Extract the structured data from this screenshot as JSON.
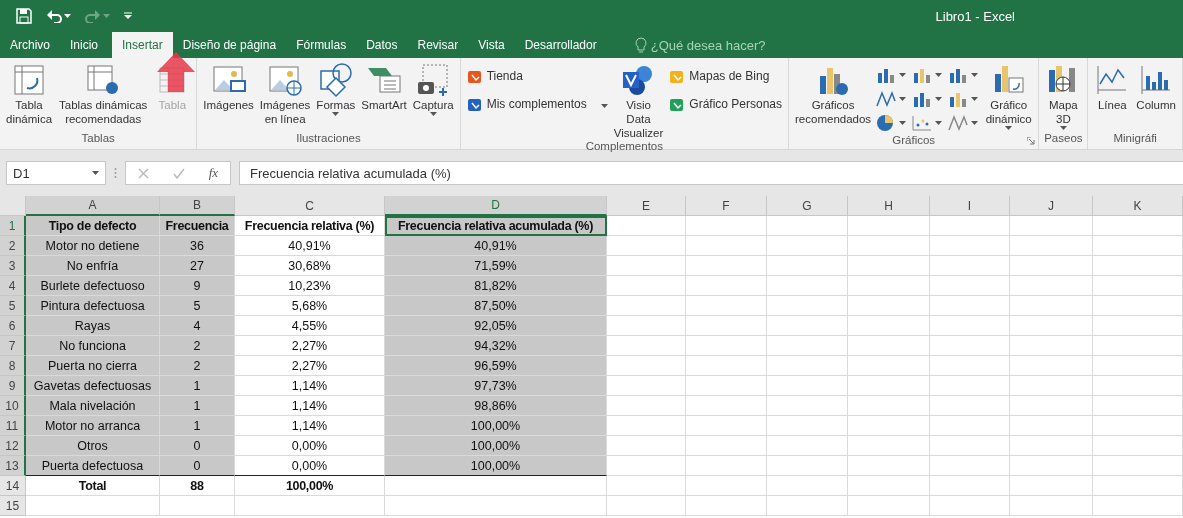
{
  "window": {
    "title": "Libro1 - Excel",
    "redo_disabled": true
  },
  "tabs": [
    {
      "label": "Archivo",
      "selected": false
    },
    {
      "label": "Inicio",
      "selected": false
    },
    {
      "label": "Insertar",
      "selected": true
    },
    {
      "label": "Diseño de página",
      "selected": false
    },
    {
      "label": "Fórmulas",
      "selected": false
    },
    {
      "label": "Datos",
      "selected": false
    },
    {
      "label": "Revisar",
      "selected": false
    },
    {
      "label": "Vista",
      "selected": false
    },
    {
      "label": "Desarrollador",
      "selected": false
    }
  ],
  "tell_me": {
    "placeholder": "¿Qué desea hacer?"
  },
  "ribbon": {
    "groups": [
      {
        "label": "Tablas",
        "items": [
          {
            "kind": "large",
            "label": "Tabla dinámica",
            "disabled": false,
            "dropdown": false
          },
          {
            "kind": "large",
            "label": "Tablas dinámicas recomendadas",
            "disabled": false,
            "dropdown": false
          },
          {
            "kind": "large",
            "label": "Tabla",
            "disabled": true,
            "dropdown": false
          }
        ]
      },
      {
        "label": "Ilustraciones",
        "items": [
          {
            "kind": "large",
            "label": "Imágenes",
            "disabled": false,
            "dropdown": false
          },
          {
            "kind": "large",
            "label": "Imágenes en línea",
            "disabled": false,
            "dropdown": false
          },
          {
            "kind": "large",
            "label": "Formas",
            "disabled": false,
            "dropdown": true
          },
          {
            "kind": "large",
            "label": "SmartArt",
            "disabled": false,
            "dropdown": false
          },
          {
            "kind": "large",
            "label": "Captura",
            "disabled": false,
            "dropdown": true
          }
        ]
      },
      {
        "label": "Complementos",
        "items": [
          {
            "kind": "stack",
            "children": [
              {
                "label": "Tienda",
                "dropdown": false
              },
              {
                "label": "Mis complementos",
                "dropdown": true
              }
            ]
          },
          {
            "kind": "large",
            "label": "Visio Data Visualizer",
            "disabled": false,
            "dropdown": false
          },
          {
            "kind": "stack",
            "children": [
              {
                "label": "Mapas de Bing",
                "dropdown": false
              },
              {
                "label": "Gráfico Personas",
                "dropdown": false
              }
            ]
          }
        ]
      },
      {
        "label": "Gráficos",
        "launcher": true,
        "items": [
          {
            "kind": "large",
            "label": "Gráficos recomendados",
            "disabled": false,
            "dropdown": false
          },
          {
            "kind": "chartgrid"
          },
          {
            "kind": "large",
            "label": "Gráfico dinámico",
            "disabled": false,
            "dropdown": true
          }
        ]
      },
      {
        "label": "Paseos",
        "items": [
          {
            "kind": "large",
            "label": "Mapa 3D",
            "disabled": false,
            "dropdown": true
          }
        ]
      },
      {
        "label": "Minigráfi",
        "items": [
          {
            "kind": "large",
            "label": "Línea",
            "disabled": false,
            "dropdown": false
          },
          {
            "kind": "large",
            "label": "Column",
            "disabled": false,
            "dropdown": false
          }
        ]
      }
    ]
  },
  "formula_bar": {
    "name_box": "D1",
    "fx": "fx",
    "value": "Frecuencia relativa acumulada (%)"
  },
  "columns": [
    {
      "label": "A",
      "selected": true,
      "active": false
    },
    {
      "label": "B",
      "selected": true,
      "active": false
    },
    {
      "label": "C",
      "selected": false,
      "active": false
    },
    {
      "label": "D",
      "selected": true,
      "active": true
    },
    {
      "label": "E",
      "selected": false,
      "active": false
    },
    {
      "label": "F",
      "selected": false,
      "active": false
    },
    {
      "label": "G",
      "selected": false,
      "active": false
    },
    {
      "label": "H",
      "selected": false,
      "active": false
    },
    {
      "label": "I",
      "selected": false,
      "active": false
    },
    {
      "label": "J",
      "selected": false,
      "active": false
    },
    {
      "label": "K",
      "selected": false,
      "active": false
    }
  ],
  "rows": [
    {
      "number": "1",
      "kind": "header",
      "selected": true,
      "active": true,
      "cells": [
        "Tipo de defecto",
        "Frecuencia",
        "Frecuencia relativa (%)",
        "Frecuencia relativa acumulada (%)"
      ]
    },
    {
      "number": "2",
      "kind": "data",
      "selected": true,
      "active": false,
      "cells": [
        "Motor no detiene",
        "36",
        "40,91%",
        "40,91%"
      ]
    },
    {
      "number": "3",
      "kind": "data",
      "selected": true,
      "active": false,
      "cells": [
        "No enfría",
        "27",
        "30,68%",
        "71,59%"
      ]
    },
    {
      "number": "4",
      "kind": "data",
      "selected": true,
      "active": false,
      "cells": [
        "Burlete defectuoso",
        "9",
        "10,23%",
        "81,82%"
      ]
    },
    {
      "number": "5",
      "kind": "data",
      "selected": true,
      "active": false,
      "cells": [
        "Pintura defectuosa",
        "5",
        "5,68%",
        "87,50%"
      ]
    },
    {
      "number": "6",
      "kind": "data",
      "selected": true,
      "active": false,
      "cells": [
        "Rayas",
        "4",
        "4,55%",
        "92,05%"
      ]
    },
    {
      "number": "7",
      "kind": "data",
      "selected": true,
      "active": false,
      "cells": [
        "No funciona",
        "2",
        "2,27%",
        "94,32%"
      ]
    },
    {
      "number": "8",
      "kind": "data",
      "selected": true,
      "active": false,
      "cells": [
        "Puerta no cierra",
        "2",
        "2,27%",
        "96,59%"
      ]
    },
    {
      "number": "9",
      "kind": "data",
      "selected": true,
      "active": false,
      "cells": [
        "Gavetas defectuosas",
        "1",
        "1,14%",
        "97,73%"
      ]
    },
    {
      "number": "10",
      "kind": "data",
      "selected": true,
      "active": false,
      "cells": [
        "Mala nivelación",
        "1",
        "1,14%",
        "98,86%"
      ]
    },
    {
      "number": "11",
      "kind": "data",
      "selected": true,
      "active": false,
      "cells": [
        "Motor no arranca",
        "1",
        "1,14%",
        "100,00%"
      ]
    },
    {
      "number": "12",
      "kind": "data",
      "selected": true,
      "active": false,
      "cells": [
        "Otros",
        "0",
        "0,00%",
        "100,00%"
      ]
    },
    {
      "number": "13",
      "kind": "data",
      "selected": true,
      "active": false,
      "cells": [
        "Puerta defectuosa",
        "0",
        "0,00%",
        "100,00%"
      ]
    },
    {
      "number": "14",
      "kind": "total",
      "selected": false,
      "active": false,
      "cells": [
        "Total",
        "88",
        "100,00%"
      ]
    },
    {
      "number": "15",
      "kind": "data",
      "selected": false,
      "active": false,
      "cells": []
    }
  ]
}
